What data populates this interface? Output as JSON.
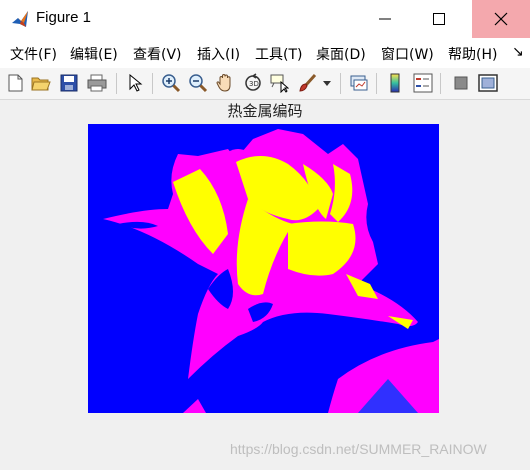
{
  "window": {
    "title": "Figure 1",
    "minimize_symbol": "—",
    "maximize_symbol": "☐",
    "close_symbol": "✕"
  },
  "menu": {
    "items": [
      {
        "label": "文件(F)"
      },
      {
        "label": "编辑(E)"
      },
      {
        "label": "查看(V)"
      },
      {
        "label": "插入(I)"
      },
      {
        "label": "工具(T)"
      },
      {
        "label": "桌面(D)"
      },
      {
        "label": "窗口(W)"
      },
      {
        "label": "帮助(H)"
      }
    ],
    "overflow_symbol": "↘"
  },
  "toolbar": {
    "buttons": [
      "new-figure-icon",
      "open-file-icon",
      "save-icon",
      "print-icon",
      "select-pointer-icon",
      "zoom-in-icon",
      "zoom-out-icon",
      "pan-hand-icon",
      "rotate-3d-icon",
      "data-cursor-icon",
      "brush-icon",
      "link-plot-icon",
      "colorbar-icon",
      "legend-icon",
      "hide-plot-tools-icon",
      "show-plot-tools-icon"
    ]
  },
  "figure": {
    "axes_title": "热金属编码"
  },
  "colors": {
    "background": "#0000ff",
    "petal_primary": "#ff00ff",
    "petal_highlight": "#ffff00",
    "close_button": "#f4a8ad"
  },
  "watermark": "https://blog.csdn.net/SUMMER_RAINOW"
}
